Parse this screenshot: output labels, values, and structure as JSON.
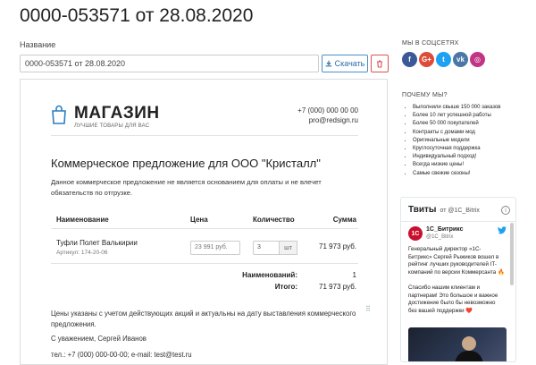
{
  "page_title": "0000-053571 от 28.08.2020",
  "form": {
    "name_label": "Название",
    "name_value": "0000-053571 от 28.08.2020",
    "download_label": "Скачать"
  },
  "document": {
    "brand": "МАГАЗИН",
    "tagline": "ЛУЧШИЕ ТОВАРЫ ДЛЯ ВАС",
    "phone": "+7 (000) 000 00 00",
    "email": "pro@redsign.ru",
    "title": "Коммерческое предложение для ООО \"Кристалл\"",
    "note": "Данное коммерческое предложение не является основанием для оплаты и не влечет обязательств по отгрузке.",
    "table": {
      "headers": [
        "Наименование",
        "Цена",
        "Количество",
        "Сумма"
      ],
      "rows": [
        {
          "name": "Туфли Полет Валькирии",
          "sku": "Артикул: 174-20-06",
          "price": "23 991 руб.",
          "qty": "3",
          "unit": "шт",
          "sum": "71 973 руб."
        }
      ],
      "count_label": "Наименований:",
      "count_value": "1",
      "total_label": "Итого:",
      "total_value": "71 973 руб."
    },
    "footer_text": "Цены указаны с учетом действующих акций и актуальны на дату выставления коммерческого предложения.",
    "regards": "С уважением, Сергей Иванов",
    "contact_line": "тел.: +7 (000) 000-00-00; e-mail: test@test.ru"
  },
  "sidebar": {
    "social_title": "МЫ В СОЦСЕТЯХ",
    "social": [
      {
        "icon": "facebook-icon",
        "glyph": "f",
        "color": "#3b5998"
      },
      {
        "icon": "google-plus-icon",
        "glyph": "G+",
        "color": "#dd4b39"
      },
      {
        "icon": "twitter-icon",
        "glyph": "t",
        "color": "#1da1f2"
      },
      {
        "icon": "vk-icon",
        "glyph": "vk",
        "color": "#4a76a8"
      },
      {
        "icon": "instagram-icon",
        "glyph": "◎",
        "color": "#c13584"
      }
    ],
    "why_title": "ПОЧЕМУ МЫ?",
    "why_items": [
      "Выполнили свыше 150 000 заказов",
      "Более 10 лет успешной работы",
      "Более 50 000 покупателей",
      "Контракты с домами мод",
      "Оригинальные модели",
      "Круглосуточная поддержка",
      "Индивидуальный подход!",
      "Всегда низкие цены!",
      "Самые свежие сезоны!"
    ],
    "twitter": {
      "title": "Твиты",
      "by": "от @1C_Bitrix",
      "author": "1С_Битрикс",
      "handle": "@1C_Bitrix",
      "avatar": "1С",
      "text": "Генеральный директор «1С-Битрикс» Сергей Рыжиков вошел в рейтинг лучших руководителей IT-компаний по версии Коммерсанта 🔥\n\nСпасибо нашим клиентам и партнерам! Это большое и важное достижение было бы невозможно без вашей поддержки ❤️"
    }
  }
}
